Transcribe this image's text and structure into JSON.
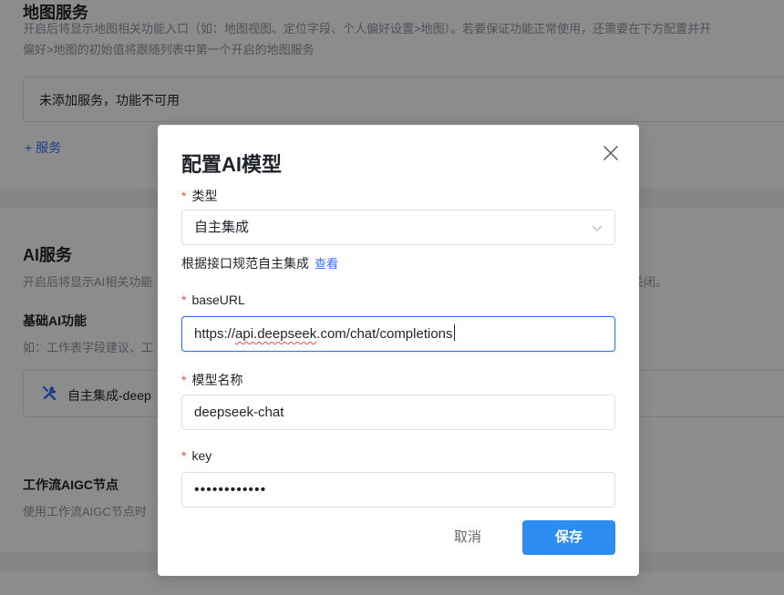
{
  "background": {
    "map_section": {
      "title": "地图服务",
      "desc_line1": "开启后将显示地图相关功能入口（如：地图视图、定位字段、个人偏好设置>地图）。若要保证功能正常使用，还需要在下方配置并开",
      "desc_line2": "偏好>地图的初始值将跟随列表中第一个开启的地图服务",
      "empty_text": "未添加服务，功能不可用",
      "add_label": "+ 服务"
    },
    "ai_section": {
      "title": "AI服务",
      "desc_left": "开启后将显示AI相关功能",
      "desc_right": "关闭。",
      "basic_title": "基础AI功能",
      "basic_desc": "如：工作表字段建议、工",
      "service_item": "自主集成-deep",
      "workflow_title": "工作流AIGC节点",
      "workflow_desc": "使用工作流AIGC节点时"
    }
  },
  "modal": {
    "title": "配置AI模型",
    "type": {
      "label": "类型",
      "value": "自主集成"
    },
    "hint": {
      "text": "根据接口规范自主集成",
      "link": "查看"
    },
    "base_url": {
      "label": "baseURL",
      "prefix": "https://",
      "squiggle": "api.deepseek",
      "suffix": ".com/chat/completions"
    },
    "model_name": {
      "label": "模型名称",
      "value": "deepseek-chat"
    },
    "key": {
      "label": "key",
      "masked_value": "••••••••••••"
    },
    "required_mark": "*",
    "cancel_label": "取消",
    "save_label": "保存"
  },
  "colors": {
    "accent": "#3370ff",
    "primary_button": "#2d8cf0",
    "required": "#f54a45",
    "overlay": "rgba(0,0,0,0.45)"
  },
  "icons": {
    "close": "close-icon",
    "dropdown": "chevron-down-icon",
    "tool": "tools-icon"
  }
}
